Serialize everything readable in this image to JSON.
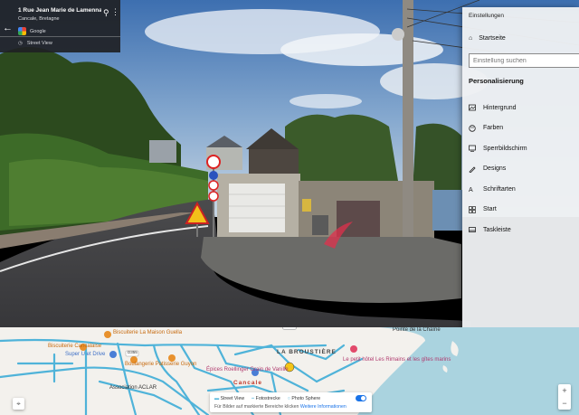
{
  "streetview": {
    "address": "1 Rue Jean Marie de Lamennais",
    "locality": "Cancale, Bretagne",
    "provider": "Google",
    "mode": "Street View"
  },
  "settings": {
    "window_title": "Einstellungen",
    "home_label": "Startseite",
    "search_placeholder": "Einstellung suchen",
    "section_title": "Personalisierung",
    "items": [
      {
        "label": "Hintergrund",
        "icon": "image-icon"
      },
      {
        "label": "Farben",
        "icon": "palette-icon"
      },
      {
        "label": "Sperrbildschirm",
        "icon": "lock-screen-icon"
      },
      {
        "label": "Designs",
        "icon": "brush-icon"
      },
      {
        "label": "Schriftarten",
        "icon": "font-icon"
      },
      {
        "label": "Start",
        "icon": "start-icon"
      },
      {
        "label": "Taskleiste",
        "icon": "taskbar-icon"
      }
    ]
  },
  "map": {
    "places": [
      {
        "label": "Biscuiterie La Maison Guella",
        "color": "orange"
      },
      {
        "label": "Biscuiterie Cancalaise",
        "color": "orange"
      },
      {
        "label": "Super U et Drive",
        "color": "blue"
      },
      {
        "label": "Boulangerie Patisserie Guyon",
        "color": "orange"
      },
      {
        "label": "Épices Roellinger Grain de Vanille",
        "color": "purple"
      },
      {
        "label": "Cancale",
        "color": "dark"
      },
      {
        "label": "LA BROUSTIÈRE",
        "color": "dark"
      },
      {
        "label": "Le petit hôtel Les Rimains et les gîtes marins",
        "color": "purple"
      },
      {
        "label": "Association ACLAR",
        "color": "dark"
      },
      {
        "label": "Pointe de la Chaîne",
        "color": "dark"
      }
    ],
    "road_label": "D355",
    "legend": {
      "street_view": "Street View",
      "photo_path": "Fotostrecke",
      "photo_sphere": "Photo Sphere",
      "note": "Für Bilder auf markierte Bereiche klicken",
      "more_info": "Weitere Informationen"
    },
    "zoom_in": "+",
    "zoom_out": "−"
  }
}
